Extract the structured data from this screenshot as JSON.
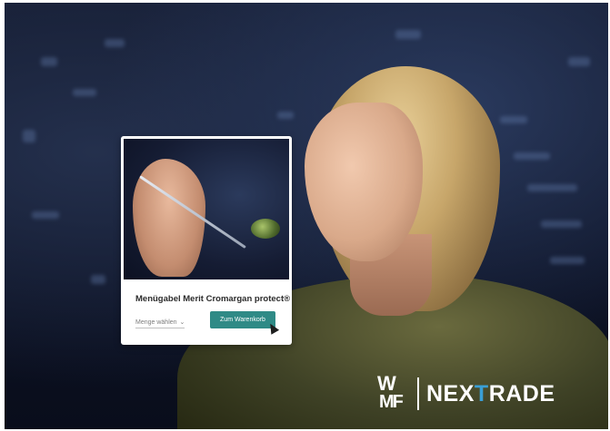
{
  "product_card": {
    "title": "Menügabel Merit Cromargan protect®",
    "quantity_placeholder": "Menge wählen",
    "cart_button_label": "Zum Warenkorb"
  },
  "logo": {
    "wmf_top": "W",
    "wmf_bottom": "MF",
    "brand_prefix": "NEX",
    "brand_accent": "T",
    "brand_suffix": "RADE"
  },
  "colors": {
    "button": "#2f8a86",
    "accent": "#3a9fd6",
    "background": "#0d1326"
  }
}
